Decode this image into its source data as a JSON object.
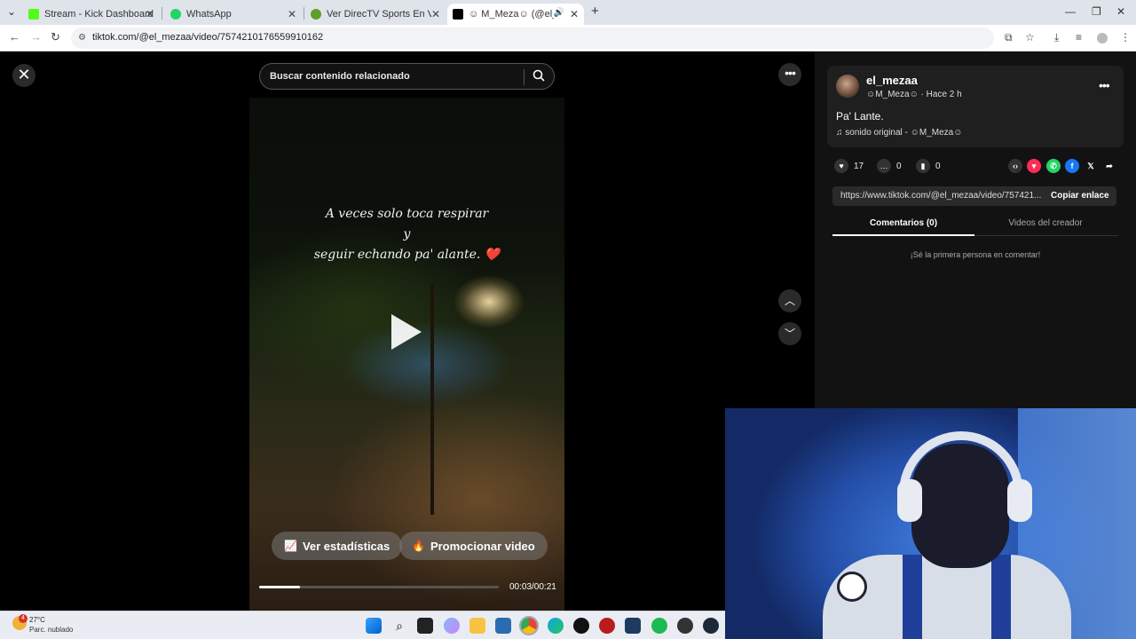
{
  "browser": {
    "tabs": [
      {
        "title": "Stream - Kick Dashboard",
        "icon": "kick-icon",
        "color": "#53fc18"
      },
      {
        "title": "WhatsApp",
        "icon": "whatsapp-icon",
        "color": "#25d366"
      },
      {
        "title": "Ver DirecTV Sports En Vivo Gra",
        "icon": "globe-icon",
        "color": "#5aa02c"
      },
      {
        "title": "☺ M_Meza☺ (@el_mezaa",
        "icon": "tiktok-icon",
        "color": "#000000"
      }
    ],
    "url": "tiktok.com/@el_mezaa/video/7574210176559910162"
  },
  "video": {
    "search_placeholder": "Buscar contenido relacionado",
    "overlay_lines": [
      "A veces solo toca respirar",
      "y",
      "seguir echando pa' alante. ❤️"
    ],
    "stats_button": "Ver estadísticas",
    "promote_button": "Promocionar video",
    "progress": 0.17,
    "time": "00:03/00:21"
  },
  "panel": {
    "username": "el_mezaa",
    "nickname": "☺M_Meza☺",
    "posted": "· Hace 2 h",
    "description": "Pa' Lante.",
    "music": "sonido original - ☺M_Meza☺",
    "likes": "17",
    "comments": "0",
    "saves": "0",
    "link": "https://www.tiktok.com/@el_mezaa/video/757421...",
    "copy_label": "Copiar enlace",
    "tab_comments": "Comentarios (0)",
    "tab_creator": "Videos del creador",
    "empty_comments": "¡Sé la primera persona en comentar!"
  },
  "taskbar": {
    "temperature": "27°C",
    "condition": "Parc. nublado",
    "badge": "4"
  },
  "colors": {
    "accent_tiktok": "#fe2c55",
    "panel_bg": "#121212"
  }
}
